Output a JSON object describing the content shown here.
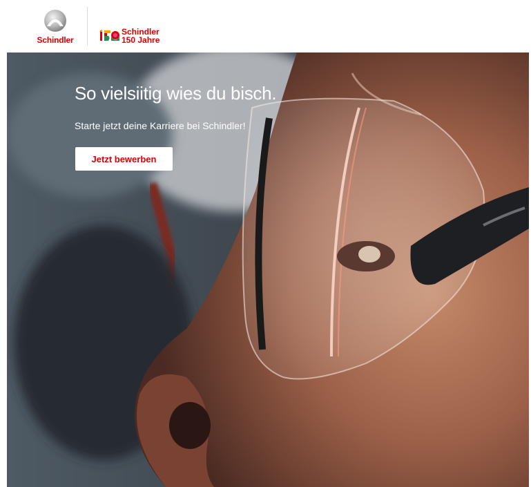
{
  "header": {
    "logo_text": "Schindler",
    "anniversary": {
      "line1": "Schindler",
      "line2": "150 Jahre"
    }
  },
  "hero": {
    "title": "So vielsiitig wies du bisch.",
    "subtitle": "Starte jetzt deine Karriere bei Schindler!",
    "cta_label": "Jetzt bewerben"
  },
  "colors": {
    "brand_red": "#dc0000",
    "text_light": "#ffffff"
  },
  "icons": [
    "schindler-logo-icon",
    "anniversary-150-icon"
  ]
}
